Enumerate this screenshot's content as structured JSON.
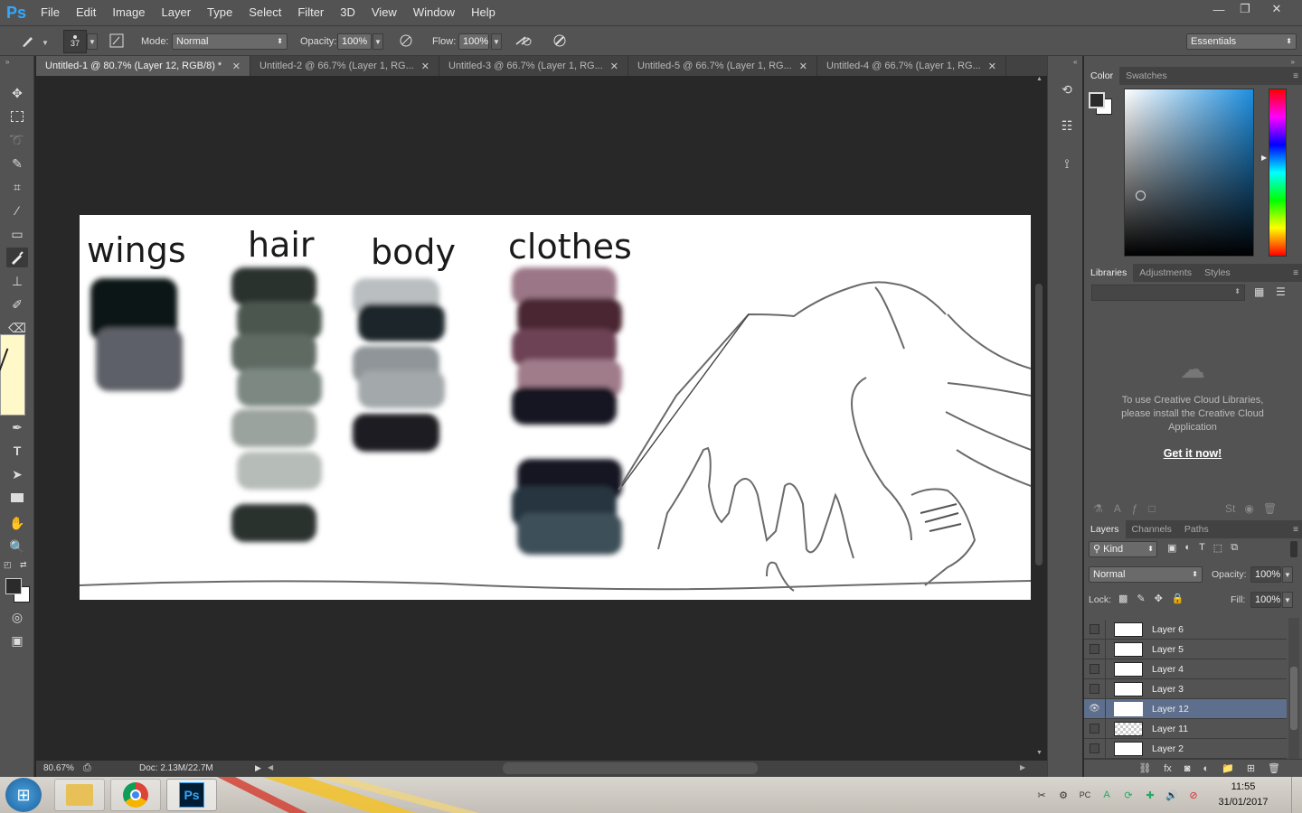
{
  "app": {
    "logo": "Ps"
  },
  "menu": [
    "File",
    "Edit",
    "Image",
    "Layer",
    "Type",
    "Select",
    "Filter",
    "3D",
    "View",
    "Window",
    "Help"
  ],
  "window_controls": {
    "minimize": "—",
    "restore": "❐",
    "close": "✕"
  },
  "options": {
    "brush_size": "37",
    "mode_label": "Mode:",
    "mode_value": "Normal",
    "opacity_label": "Opacity:",
    "opacity_value": "100%",
    "flow_label": "Flow:",
    "flow_value": "100%",
    "workspace": "Essentials"
  },
  "doc_tabs": [
    {
      "label": "Untitled-1 @ 80.7% (Layer 12, RGB/8) *",
      "active": true
    },
    {
      "label": "Untitled-2 @ 66.7% (Layer 1, RG...",
      "active": false
    },
    {
      "label": "Untitled-3 @ 66.7% (Layer 1, RG...",
      "active": false
    },
    {
      "label": "Untitled-5 @ 66.7% (Layer 1, RG...",
      "active": false
    },
    {
      "label": "Untitled-4 @ 66.7% (Layer 1, RG...",
      "active": false
    }
  ],
  "canvas": {
    "labels": [
      "wings",
      "hair",
      "body",
      "clothes"
    ],
    "swatches": {
      "wings": [
        "#0e1217",
        "#5d6068"
      ],
      "hair": [
        "#2a322d",
        "#4b5650",
        "#5f6b63",
        "#7c8881",
        "#9ba39e",
        "#b6bcb8",
        "#2a322e"
      ],
      "body": [
        "#b9bec0",
        "#1f252c",
        "#8f9598",
        "#a3a8aa",
        "#1c1f24"
      ],
      "clothes": [
        "#9b7686",
        "#4a2530",
        "#6d4254",
        "#a07b8b",
        "#131820",
        "#121920",
        "#273541",
        "#3d5058"
      ]
    }
  },
  "status": {
    "zoom": "80.67%",
    "doc": "Doc: 2.13M/22.7M"
  },
  "color_panel": {
    "tabs": [
      "Color",
      "Swatches"
    ],
    "foreground": "#2b2b2b",
    "background": "#ffffff"
  },
  "libraries_panel": {
    "tabs": [
      "Libraries",
      "Adjustments",
      "Styles"
    ],
    "message": "To use Creative Cloud Libraries, please install the Creative Cloud Application",
    "link": "Get it now!"
  },
  "layers_panel": {
    "tabs": [
      "Layers",
      "Channels",
      "Paths"
    ],
    "filter": "Kind",
    "blend": "Normal",
    "opacity_label": "Opacity:",
    "opacity_value": "100%",
    "lock_label": "Lock:",
    "fill_label": "Fill:",
    "fill_value": "100%",
    "layers": [
      {
        "name": "Layer 6",
        "visible": false,
        "selected": false
      },
      {
        "name": "Layer 5",
        "visible": false,
        "selected": false
      },
      {
        "name": "Layer 4",
        "visible": false,
        "selected": false
      },
      {
        "name": "Layer 3",
        "visible": false,
        "selected": false
      },
      {
        "name": "Layer 12",
        "visible": true,
        "selected": true
      },
      {
        "name": "Layer 11",
        "visible": false,
        "selected": false
      },
      {
        "name": "Layer 2",
        "visible": false,
        "selected": false
      }
    ]
  },
  "taskbar": {
    "time": "11:55",
    "date": "31/01/2017",
    "tray_pc": "PC"
  }
}
